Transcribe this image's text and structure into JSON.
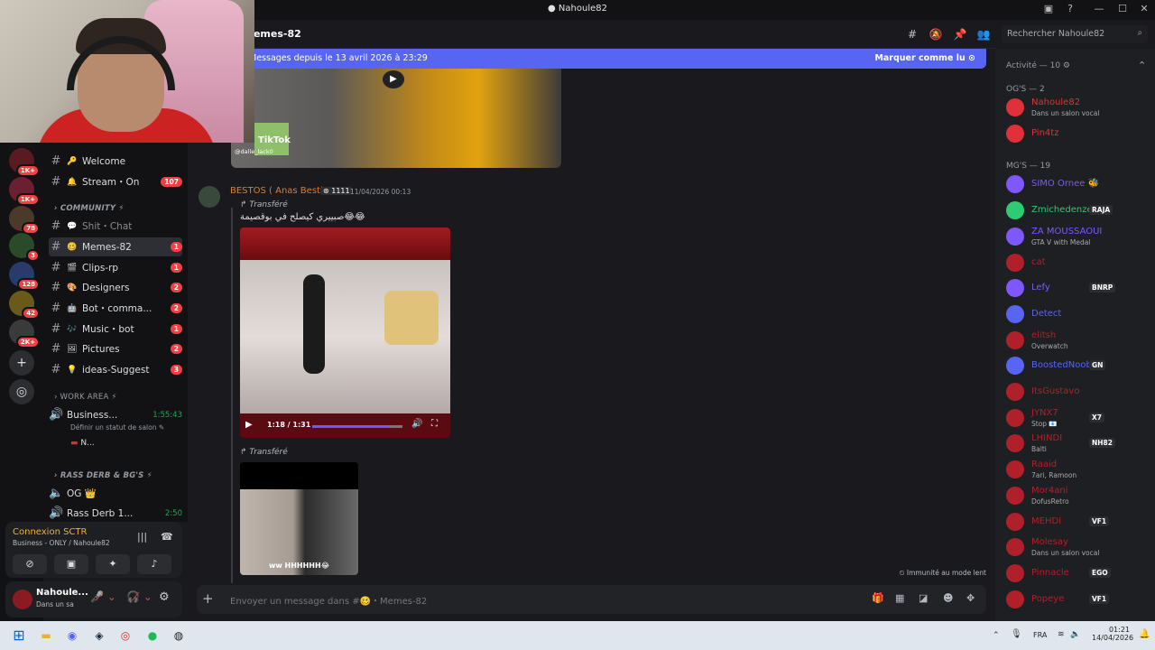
{
  "window": {
    "title": "Nahoule82"
  },
  "header": {
    "channel_name": "Memes-82",
    "search_placeholder": "Rechercher Nahoule82"
  },
  "new_messages": {
    "text": "Messages depuis le 13 avril 2026 à 23:29",
    "mark_read": "Marquer comme lu"
  },
  "channels": [
    {
      "emoji": "🔑",
      "name": "Welcome",
      "badge": "",
      "sel": false
    },
    {
      "emoji": "🔔",
      "name": "Stream・On",
      "badge": "107",
      "sel": false
    },
    {
      "emoji": "💬",
      "name": "Shit・Chat",
      "badge": "",
      "sel": false
    },
    {
      "emoji": "🥴",
      "name": "Memes-82",
      "badge": "1",
      "sel": true
    },
    {
      "emoji": "🎬",
      "name": "Clips-rp",
      "badge": "1",
      "sel": false
    },
    {
      "emoji": "🎨",
      "name": "Designers",
      "badge": "2",
      "sel": false
    },
    {
      "emoji": "🤖",
      "name": "Bot・comma...",
      "badge": "2",
      "sel": false
    },
    {
      "emoji": "🎶",
      "name": "Music・bot",
      "badge": "1",
      "sel": false
    },
    {
      "emoji": "🖼",
      "name": "Pictures",
      "badge": "2",
      "sel": false
    },
    {
      "emoji": "💡",
      "name": "ideas-Suggest",
      "badge": "3",
      "sel": false
    }
  ],
  "categories": {
    "community": "COMMUNITY",
    "work_area": "WORK AREA",
    "rass": "RASS DERB & BG'S"
  },
  "voice_channels": {
    "business": {
      "name": "Business...",
      "time": "1:55:43",
      "status": "Définir un statut de salon",
      "user": "N..."
    },
    "og": {
      "name": "OG 👑"
    },
    "rass": {
      "name": "Rass Derb 1...",
      "time": "2:50"
    }
  },
  "servers": [
    {
      "badge": "1K+"
    },
    {
      "badge": "1K+"
    },
    {
      "badge": "78"
    },
    {
      "badge": "3"
    },
    {
      "badge": "128"
    },
    {
      "badge": "42"
    },
    {
      "badge": "2K+"
    }
  ],
  "voice_connection": {
    "title": "Connexion SCTR",
    "subtitle": "Business - ONLY / Nahoule82"
  },
  "user": {
    "name": "Nahoule...",
    "status": "Dans un sa"
  },
  "message": {
    "author": "BESTOS ( Anas Best)",
    "tag": "1111",
    "time": "11/04/2026 00:13",
    "forwarded": "Transféré",
    "text": "صبييري كيصلح في بوقصيمة😂😂",
    "video_time": "1:18 / 1:31",
    "forwarded2": "Transféré",
    "tiktok": "TikTok",
    "tiktok_handle": "@dalle_lack0",
    "caption2": "ww HHHHHH😂"
  },
  "slow_mode": "Immunité au mode lent",
  "input_placeholder": "Envoyer un message dans #🥴・Memes-82",
  "activity": {
    "label": "Activité — 10"
  },
  "groups": [
    {
      "label": "OG'S — 2",
      "members": [
        {
          "name": "Nahoule82",
          "status": "Dans un salon vocal",
          "color": "#e0303a",
          "tag": ""
        },
        {
          "name": "Pin4tz",
          "status": "",
          "color": "#e0303a",
          "tag": ""
        }
      ]
    },
    {
      "label": "MG'S — 19",
      "members": [
        {
          "name": "SIMO Ornee 🐝",
          "status": "",
          "color": "#7e57ff",
          "tag": ""
        },
        {
          "name": "Zmichedenzeh",
          "status": "",
          "color": "#2ecc71",
          "tag": "RAJA"
        },
        {
          "name": "ZA MOUSSAOUI",
          "status": "GTA V with Medal",
          "color": "#7e57ff",
          "tag": ""
        },
        {
          "name": "cat",
          "status": "",
          "color": "#b0202a",
          "tag": ""
        },
        {
          "name": "Lefy",
          "status": "",
          "color": "#7e57ff",
          "tag": "BNRP"
        },
        {
          "name": "Detect",
          "status": "",
          "color": "#5865f2",
          "tag": ""
        },
        {
          "name": "elitsh",
          "status": "Overwatch",
          "color": "#b0202a",
          "tag": ""
        },
        {
          "name": "BoostedNoobie",
          "status": "",
          "color": "#5865f2",
          "tag": "GN"
        },
        {
          "name": "ItsGustavo",
          "status": "",
          "color": "#b0202a",
          "tag": ""
        },
        {
          "name": "JYNX7",
          "status": "Stop 📧",
          "color": "#b0202a",
          "tag": "X7"
        },
        {
          "name": "LHINDI",
          "status": "Balti",
          "color": "#b0202a",
          "tag": "NH82"
        },
        {
          "name": "Raaid",
          "status": "7ari, Ramoon",
          "color": "#b0202a",
          "tag": ""
        },
        {
          "name": "Mor4ani",
          "status": "DofusRetro",
          "color": "#b0202a",
          "tag": ""
        },
        {
          "name": "MEHDI",
          "status": "",
          "color": "#b0202a",
          "tag": "VF1"
        },
        {
          "name": "Molesay",
          "status": "Dans un salon vocal",
          "color": "#b0202a",
          "tag": ""
        },
        {
          "name": "Pinnacle",
          "status": "",
          "color": "#b0202a",
          "tag": "EGO"
        },
        {
          "name": "Popeye",
          "status": "",
          "color": "#b0202a",
          "tag": "VF1"
        }
      ]
    }
  ],
  "taskbar": {
    "lang": "FRA",
    "time": "01:21",
    "date": "14/04/2026"
  }
}
